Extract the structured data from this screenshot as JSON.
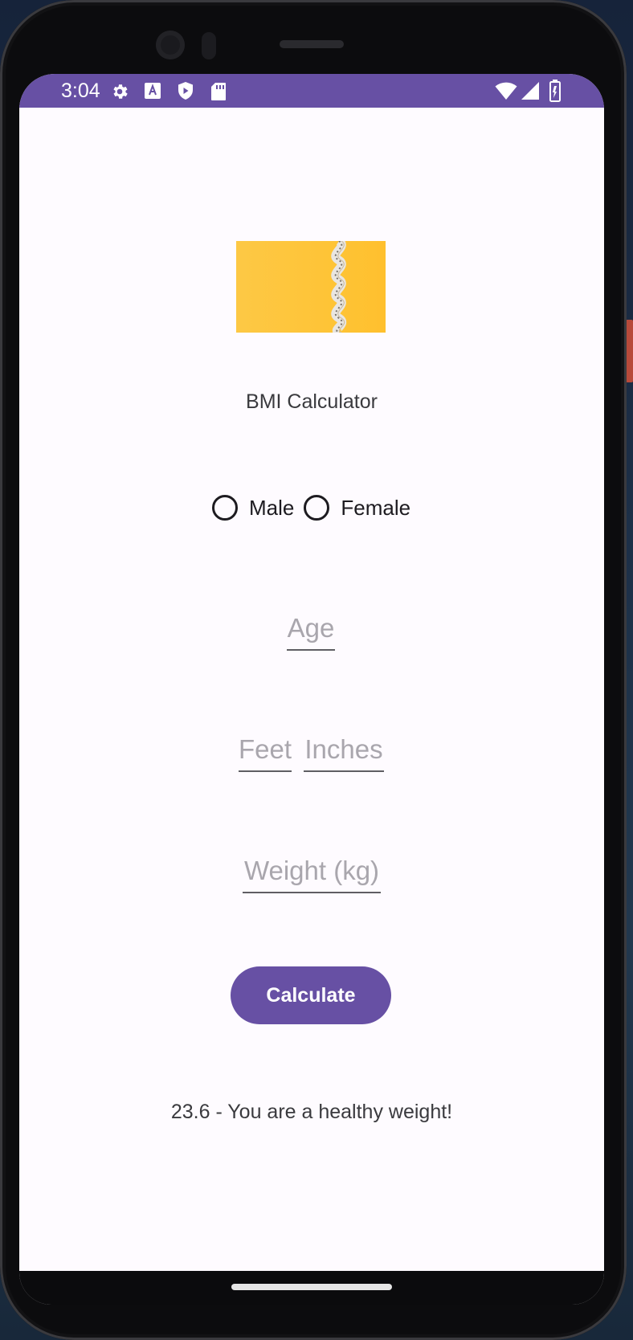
{
  "status_bar": {
    "time": "3:04",
    "background_color": "#6750a4",
    "left_icons": [
      "settings-icon",
      "font-a-icon",
      "play-protect-icon",
      "sd-card-icon"
    ],
    "right_icons": [
      "wifi-icon",
      "signal-icon",
      "battery-icon"
    ]
  },
  "app": {
    "hero_image": "measuring-tape-on-yellow-image",
    "title": "BMI Calculator",
    "gender_options": [
      {
        "label": "Male",
        "selected": false
      },
      {
        "label": "Female",
        "selected": false
      }
    ],
    "age": {
      "value": "",
      "placeholder": "Age"
    },
    "height_feet": {
      "value": "",
      "placeholder": "Feet"
    },
    "height_inches": {
      "value": "",
      "placeholder": "Inches"
    },
    "weight": {
      "value": "",
      "placeholder": "Weight (kg)"
    },
    "calculate_label": "Calculate",
    "result_text": "23.6 - You are a healthy weight!",
    "accent_color": "#6750a4"
  }
}
